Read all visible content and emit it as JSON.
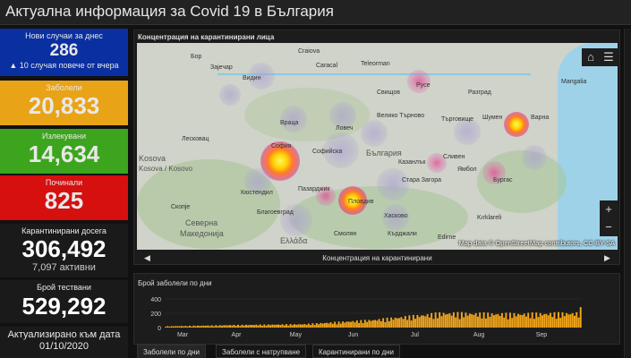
{
  "header": {
    "title": "Актуална информация за Covid 19 в България"
  },
  "cards": {
    "new_cases": {
      "label": "Нови случаи за днес",
      "value": "286",
      "sub": "▲ 10 случая повече от вчера",
      "bg": "#0a2fa0"
    },
    "infected": {
      "label": "Заболели",
      "value": "20,833",
      "bg": "#e8a317"
    },
    "recovered": {
      "label": "Излекувани",
      "value": "14,634",
      "bg": "#3ca51d"
    },
    "deaths": {
      "label": "Починали",
      "value": "825",
      "bg": "#d60f0f"
    },
    "quarantined": {
      "label": "Карантинирани досега",
      "value": "306,492",
      "sub": "7,097 активни"
    },
    "tests": {
      "label": "Брой тествани",
      "value": "529,292"
    },
    "updated": {
      "label": "Актуализирано към дата",
      "value": "01/10/2020"
    }
  },
  "map_panel": {
    "title": "Концентрация на карантинирани лица",
    "attribution": "Map data © OpenStreetMap contributors, CC-BY-SA",
    "zoom_in": "+",
    "zoom_out": "−",
    "nav_caption": "Концентрация на карантинирани",
    "nav_prev": "◀",
    "nav_next": "▶",
    "labels": {
      "zayechar": "Зајечар",
      "bor": "Бор",
      "craiova": "Craiova",
      "caracal": "Caracal",
      "teleorman": "Teleorman",
      "ruse": "Русе",
      "vidin": "Видин",
      "vratsa": "Враца",
      "svishtov": "Свищов",
      "lovech": "Ловеч",
      "veliko_tarnovo": "Велико Търново",
      "targovishte": "Търговище",
      "shumen": "Шумен",
      "varna": "Варна",
      "razgrad": "Разград",
      "mangalia": "Mangalia",
      "leskovac": "Лесковац",
      "kosovo1": "Kosova / Kosovo",
      "sofia": "София",
      "sofiyska": "Софийска",
      "bulgaria": "България",
      "kazanlak": "Казанлък",
      "sliven": "Сливен",
      "yambol": "Ямбол",
      "burgas": "Бургас",
      "pazardzhik": "Пазарджик",
      "plovdiv": "Пловдив",
      "stara_zagora": "Стара Загора",
      "haskovo": "Хасково",
      "skopje": "Скопје",
      "kyustendil": "Кюстендил",
      "blagoevgrad": "Благоевград",
      "smolyan": "Смолян",
      "kardzhali": "Кърджали",
      "edirne": "Edirne",
      "kirklareli": "Kırklareli",
      "severna": "Северна",
      "makedonija": "Македонија",
      "ellada": "Ελλάδα",
      "kosova": "Kosova"
    }
  },
  "daily_panel": {
    "title": "Брой заболели по дни",
    "y_ticks": [
      "400",
      "200",
      "0"
    ],
    "x_ticks": [
      "Mar",
      "Apr",
      "May",
      "Jun",
      "Jul",
      "Aug",
      "Sep"
    ]
  },
  "tabs": {
    "t1": "Заболели по дни",
    "t2": "Заболели с натрупване",
    "t3": "Карантинирани по дни"
  },
  "chart_data": {
    "type": "bar",
    "title": "Брой заболели по дни",
    "xlabel": "",
    "ylabel": "",
    "ylim": [
      0,
      400
    ],
    "x_range": [
      "2020-03-08",
      "2020-09-30"
    ],
    "x_tick_labels": [
      "Mar",
      "Apr",
      "May",
      "Jun",
      "Jul",
      "Aug",
      "Sep"
    ],
    "y_tick_labels": [
      "0",
      "200",
      "400"
    ],
    "color": "#f2a51a",
    "monthly_typical_daily": [
      {
        "month": "Mar",
        "value": 15
      },
      {
        "month": "Apr",
        "value": 30
      },
      {
        "month": "May",
        "value": 40
      },
      {
        "month": "Jun",
        "value": 90
      },
      {
        "month": "Jul",
        "value": 170
      },
      {
        "month": "Aug",
        "value": 160
      },
      {
        "month": "Sep",
        "value": 170
      }
    ],
    "last_value": 286
  }
}
